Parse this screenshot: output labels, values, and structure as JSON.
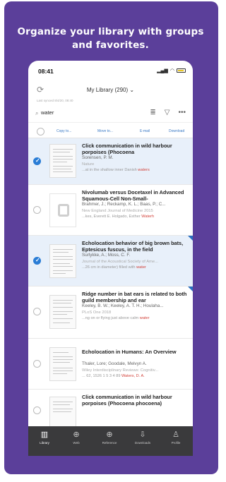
{
  "promo": {
    "headline_line1": "Organize your library with groups",
    "headline_line2": "and favorites."
  },
  "status": {
    "time": "08:41"
  },
  "nav": {
    "title": "My Library",
    "count": "(290)",
    "last_synced": "Last synced 8/4/20, 08:40"
  },
  "search": {
    "value": "water"
  },
  "actions": {
    "copy": "Copy to...",
    "move": "Move to...",
    "email": "E-mail",
    "download": "Download"
  },
  "items": [
    {
      "title": "Click communication in wild harbour porpoises (Phocoena",
      "authors": "Sorensen, P. M.",
      "journal": "Nature",
      "snippet": "...at in the shallow inner Danish ",
      "highlight": "waters",
      "selected": true
    },
    {
      "title": "Nivolumab versus Docetaxel in Advanced Squamous-Cell Non-Small-",
      "authors": "Brahmer, J.; Reckamp, K. L.; Baas, P.; C...",
      "journal": "New England Journal of Medicine 2015",
      "snippet": "...kes, Everett E. Holgado, Esther ",
      "highlight": "Waterh",
      "selected": false
    },
    {
      "title": "Echolocation behavior of big brown bats, Eptesicus fuscus, in the field",
      "authors": "Surlykke, A.; Moss, C. F.",
      "journal": "Journal of the Acoustical Society of Ame...",
      "snippet": "...26 cm in diameter) filled with ",
      "highlight": "water",
      "selected": true
    },
    {
      "title": "Ridge number in bat ears is related to both guild membership and ear",
      "authors": "Keeley, B. W.; Keeley, A. T. H.; Houlaha...",
      "journal": "PLoS One 2018",
      "snippet": "...ng on or flying just above calm ",
      "highlight": "water",
      "selected": false
    },
    {
      "title": "Echolocation in Humans: An Overview",
      "authors": "Thaler, Lore; Goodale, Melvyn A.",
      "journal": "Wiley Interdisciplinary Reviews: Cognitiv...",
      "snippet": "... 62, 1526   1 5 3 4   89   ",
      "highlight": "Waters, D. A.",
      "selected": false
    },
    {
      "title": "Click communication in wild harbour porpoises (Phocoena phocoena)",
      "authors": "",
      "journal": "",
      "snippet": "",
      "highlight": "",
      "selected": false
    }
  ],
  "tabs": [
    {
      "label": "Library",
      "icon": "library-icon"
    },
    {
      "label": "Web",
      "icon": "globe-icon"
    },
    {
      "label": "Reference",
      "icon": "add-reference-icon"
    },
    {
      "label": "Downloads",
      "icon": "download-icon"
    },
    {
      "label": "Profile",
      "icon": "person-icon"
    }
  ],
  "colors": {
    "promo_bg": "#5b3f9a",
    "accent": "#2a7dd6",
    "highlight": "#d2423a",
    "tabbar": "#3a3a3c"
  }
}
